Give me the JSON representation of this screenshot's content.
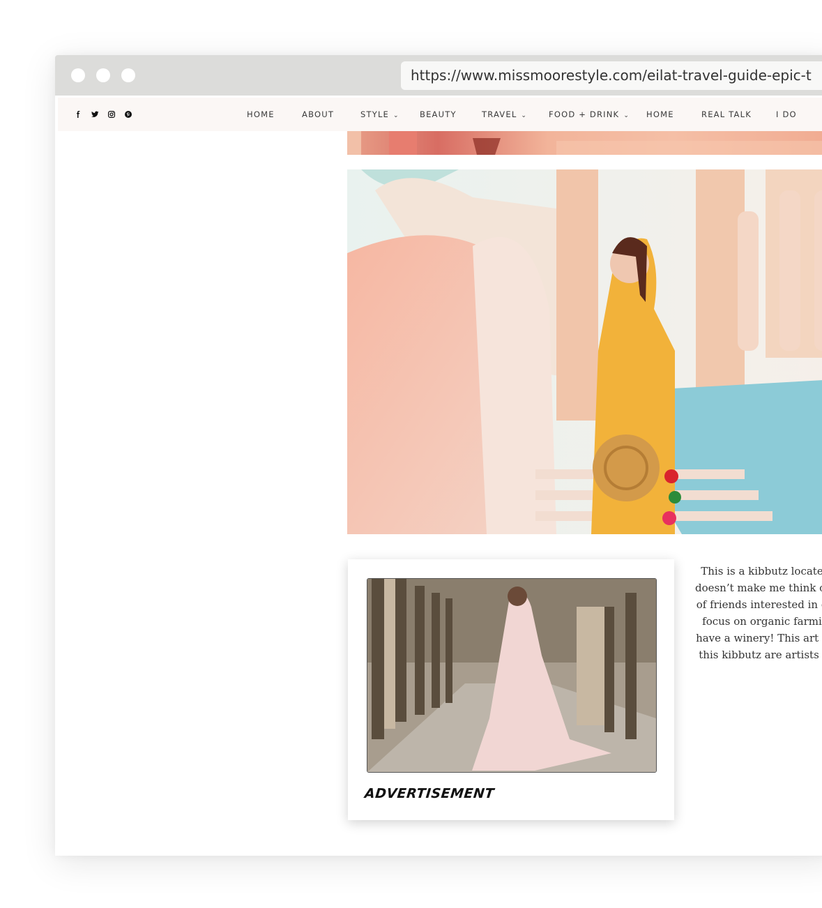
{
  "browser": {
    "url": "https://www.missmoorestyle.com/eilat-travel-guide-epic-t"
  },
  "nav": {
    "social": [
      {
        "icon": "facebook-icon"
      },
      {
        "icon": "twitter-icon"
      },
      {
        "icon": "instagram-icon"
      },
      {
        "icon": "pinterest-icon"
      }
    ],
    "items": [
      {
        "label": "HOME",
        "dropdown": false
      },
      {
        "label": "ABOUT",
        "dropdown": false
      },
      {
        "label": "STYLE",
        "dropdown": true
      },
      {
        "label": "BEAUTY",
        "dropdown": false
      },
      {
        "label": "TRAVEL",
        "dropdown": true
      },
      {
        "label": "FOOD + DRINK",
        "dropdown": true
      },
      {
        "label": "HOME",
        "dropdown": false
      },
      {
        "label": "REAL TALK",
        "dropdown": false
      },
      {
        "label": "I DO",
        "dropdown": false
      }
    ]
  },
  "ad": {
    "label": "ADVERTISEMENT"
  },
  "article": {
    "lines": [
      "This is a kibbutz located n",
      "doesn’t make me think of ep",
      "of friends interested in crea",
      "focus on organic farming,",
      "have a winery! This art cent",
      "this kibbutz are artists and"
    ]
  },
  "colors": {
    "chrome": "#dcdcda",
    "navbar": "#fbf7f5",
    "text": "#3a3a3a"
  }
}
